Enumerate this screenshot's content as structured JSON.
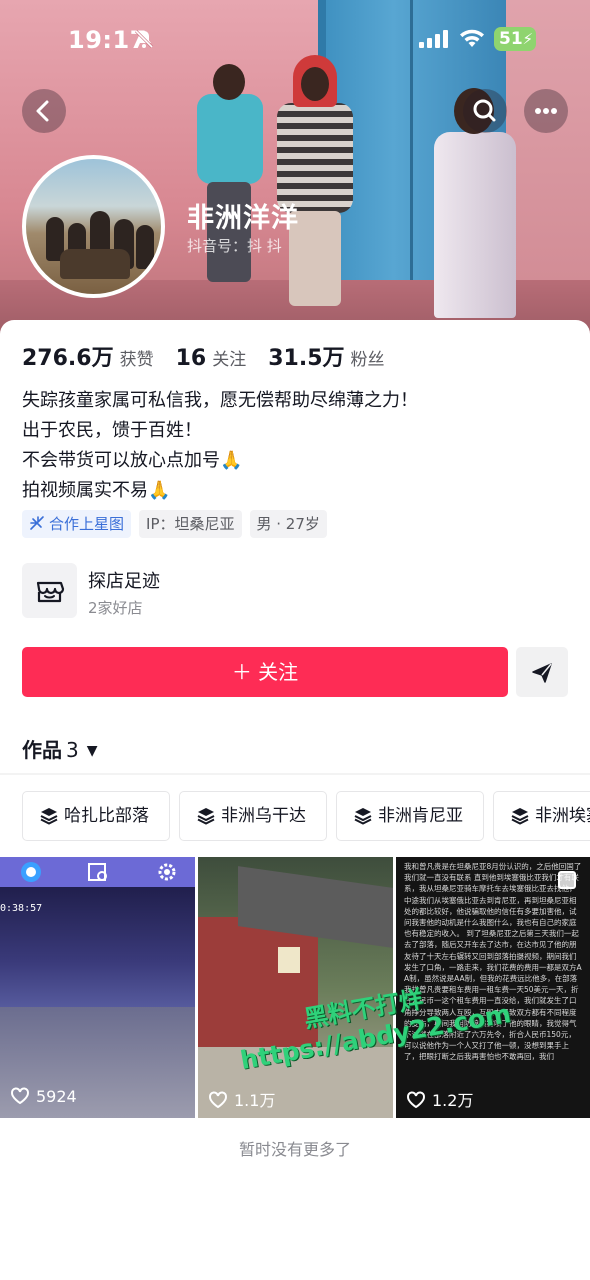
{
  "status_bar": {
    "time": "19:17",
    "battery": "51"
  },
  "profile": {
    "nickname": "非洲洋洋",
    "douyin_id": "抖音号：抖 抖",
    "stats": [
      {
        "value": "276.6万",
        "label": "获赞"
      },
      {
        "value": "16",
        "label": "关注"
      },
      {
        "value": "31.5万",
        "label": "粉丝"
      }
    ],
    "bio": [
      "失踪孩童家属可私信我，愿无偿帮助尽绵薄之力！",
      "出于农民，馈于百姓！",
      "不会带货可以放心点加号🙏",
      "拍视频属实不易🙏"
    ],
    "tags": {
      "star": "合作上星图",
      "ip": "IP：坦桑尼亚",
      "gender_age": "男 · 27岁"
    }
  },
  "shop": {
    "title": "探店足迹",
    "subtitle": "2家好店"
  },
  "actions": {
    "follow_label": "＋ 关注"
  },
  "works": {
    "label": "作品",
    "count": "3"
  },
  "collections": [
    "哈扎比部落",
    "非洲乌干达",
    "非洲肯尼亚",
    "非洲埃塞"
  ],
  "videos": [
    {
      "likes": "5924",
      "clock": "0:38:57"
    },
    {
      "likes": "1.1万"
    },
    {
      "likes": "1.2万",
      "text": "我和曾凡贵是在坦桑尼亚8月份认识的，之后他回国了我们就一直没有联系 直到他到埃塞俄比亚我们才有联系，我从坦桑尼亚骑车摩托车去埃塞俄比亚去找他，中途我们从埃塞俄比亚去到肯尼亚，再到坦桑尼亚相处的都比较好，他说骗取他的信任有多要加害他，试问我害他的动机是什么我图什么，我也有自己的家庭也有稳定的收入。 到了坦桑尼亚之后第三天我们一起去了部落，随后又开车去了达市，在达市见了他的朋友待了十天左右辗转又回到部落拍摄视频，期间我们发生了口角，一路走来，我们花费的费用一都是双方AA制，虽然说是AA制，但我的花费远比他多，在部落我找曾凡贵要租车费用一租车费一天50美元一天，折合人民币一这个租车费用一直没给，我们就发生了口角挣分导致两人互殴，互殴中导致双方都有不同程度的受伤，期间我用防狼喷雾喷了他的眼睛，我觉得气不过就在部落附近了六万先令，折合人民币150元，可以说他作为一个人又打了他一顿，没想到果手上了，把眼打断之后我再害怕也不敢再回，我们"
    }
  ],
  "watermark": {
    "line1": "黑料不打烊",
    "line2": "https://abdy22.com"
  },
  "footer": {
    "no_more": "暂时没有更多了"
  }
}
